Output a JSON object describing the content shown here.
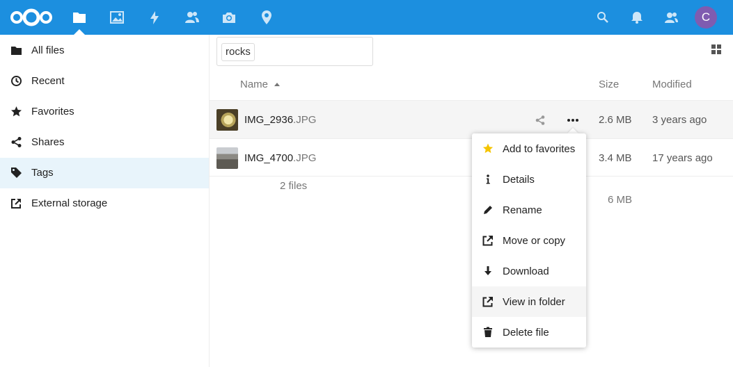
{
  "header": {
    "apps": [
      {
        "name": "files",
        "icon": "folder-icon",
        "active": true
      },
      {
        "name": "gallery",
        "icon": "image-icon"
      },
      {
        "name": "activity",
        "icon": "lightning-icon"
      },
      {
        "name": "contacts",
        "icon": "users-icon"
      },
      {
        "name": "photos",
        "icon": "camera-icon"
      },
      {
        "name": "maps",
        "icon": "map-pin-icon"
      }
    ],
    "right": [
      "search-icon",
      "bell-icon",
      "contacts-menu-icon"
    ],
    "avatar_letter": "C",
    "colors": {
      "bar": "#1C8FDF",
      "avatar": "#7F5CB0"
    }
  },
  "sidebar": {
    "items": [
      {
        "label": "All files",
        "icon": "folder-icon"
      },
      {
        "label": "Recent",
        "icon": "clock-icon"
      },
      {
        "label": "Favorites",
        "icon": "star-icon"
      },
      {
        "label": "Shares",
        "icon": "share-icon"
      },
      {
        "label": "Tags",
        "icon": "tag-icon",
        "active": true
      },
      {
        "label": "External storage",
        "icon": "external-icon"
      }
    ]
  },
  "filter": {
    "tag": "rocks"
  },
  "table": {
    "columns": {
      "name": "Name",
      "size": "Size",
      "modified": "Modified"
    },
    "rows": [
      {
        "name": "IMG_2936",
        "ext": ".JPG",
        "size": "2.6 MB",
        "modified": "3 years ago"
      },
      {
        "name": "IMG_4700",
        "ext": ".JPG",
        "size": "3.4 MB",
        "modified": "17 years ago"
      }
    ],
    "summary": {
      "count": "2 files",
      "size": "6 MB"
    }
  },
  "menu": {
    "items": [
      {
        "label": "Add to favorites",
        "icon": "star-icon"
      },
      {
        "label": "Details",
        "icon": "info-icon"
      },
      {
        "label": "Rename",
        "icon": "pencil-icon"
      },
      {
        "label": "Move or copy",
        "icon": "external-icon"
      },
      {
        "label": "Download",
        "icon": "download-icon"
      },
      {
        "label": "View in folder",
        "icon": "external-icon",
        "hover": true
      },
      {
        "label": "Delete file",
        "icon": "trash-icon"
      }
    ],
    "colors": {
      "favorite_star": "#F5C400"
    }
  }
}
